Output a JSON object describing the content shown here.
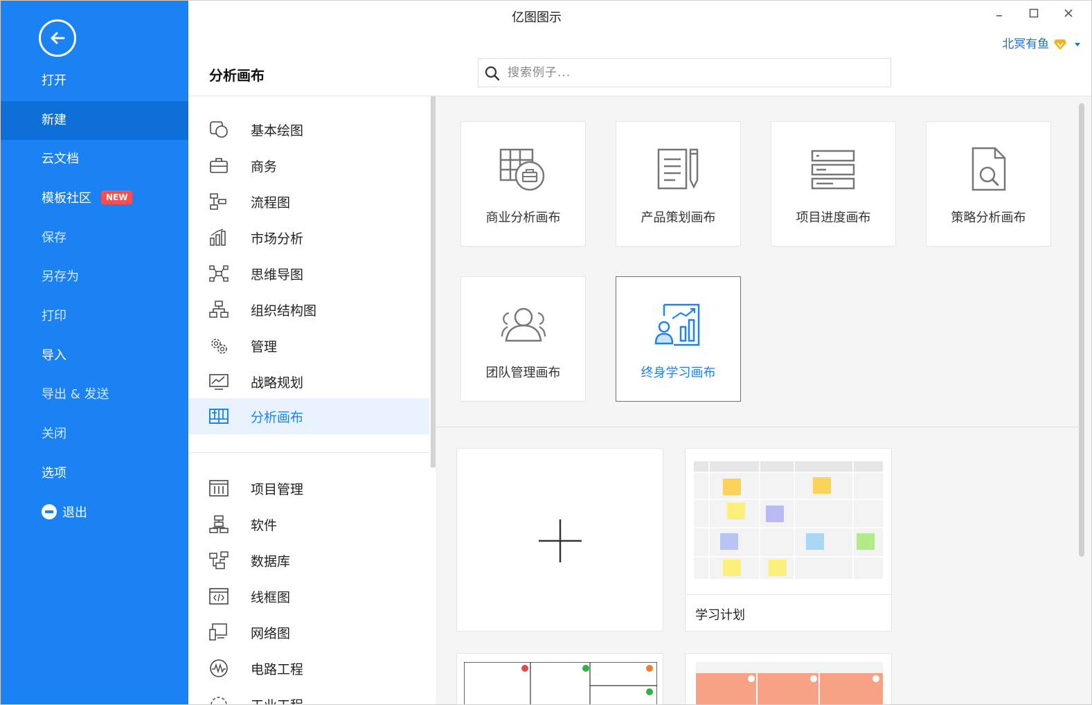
{
  "window": {
    "title": "亿图图示"
  },
  "user": {
    "name": "北冥有鱼"
  },
  "sidebar": {
    "items": [
      {
        "label": "打开",
        "style": "normal"
      },
      {
        "label": "新建",
        "style": "active"
      },
      {
        "label": "云文档",
        "style": "normal"
      },
      {
        "label": "模板社区",
        "style": "normal",
        "badge": "NEW"
      },
      {
        "label": "保存",
        "style": "dim"
      },
      {
        "label": "另存为",
        "style": "dim"
      },
      {
        "label": "打印",
        "style": "dim"
      },
      {
        "label": "导入",
        "style": "normal"
      },
      {
        "label": "导出 & 发送",
        "style": "dim"
      },
      {
        "label": "关闭",
        "style": "dim"
      },
      {
        "label": "选项",
        "style": "normal"
      },
      {
        "label": "退出",
        "style": "normal"
      }
    ]
  },
  "header": {
    "page_title": "分析画布",
    "search_placeholder": "搜索例子..."
  },
  "categories": [
    {
      "label": "基本绘图",
      "icon": "shapes-icon"
    },
    {
      "label": "商务",
      "icon": "briefcase-icon"
    },
    {
      "label": "流程图",
      "icon": "flowchart-icon"
    },
    {
      "label": "市场分析",
      "icon": "bar-chart-icon"
    },
    {
      "label": "思维导图",
      "icon": "mindmap-icon"
    },
    {
      "label": "组织结构图",
      "icon": "org-chart-icon"
    },
    {
      "label": "管理",
      "icon": "gears-icon"
    },
    {
      "label": "战略规划",
      "icon": "monitor-chart-icon"
    },
    {
      "label": "分析画布",
      "icon": "canvas-grid-icon",
      "active": true
    },
    {
      "label": "项目管理",
      "icon": "project-icon"
    },
    {
      "label": "软件",
      "icon": "software-icon"
    },
    {
      "label": "数据库",
      "icon": "database-icon"
    },
    {
      "label": "线框图",
      "icon": "wireframe-icon"
    },
    {
      "label": "网络图",
      "icon": "network-icon"
    },
    {
      "label": "电路工程",
      "icon": "circuit-icon"
    },
    {
      "label": "工业工程",
      "icon": "industry-icon"
    }
  ],
  "subcategories": [
    {
      "label": "商业分析画布",
      "icon": "business-canvas-icon"
    },
    {
      "label": "产品策划画布",
      "icon": "product-plan-icon"
    },
    {
      "label": "项目进度画布",
      "icon": "progress-list-icon"
    },
    {
      "label": "策略分析画布",
      "icon": "doc-search-icon"
    },
    {
      "label": "团队管理画布",
      "icon": "team-icon"
    },
    {
      "label": "终身学习画布",
      "icon": "learning-icon",
      "active": true
    }
  ],
  "templates": [
    {
      "label": "",
      "kind": "new",
      "icon": "plus-icon"
    },
    {
      "label": "学习计划",
      "kind": "template"
    }
  ]
}
